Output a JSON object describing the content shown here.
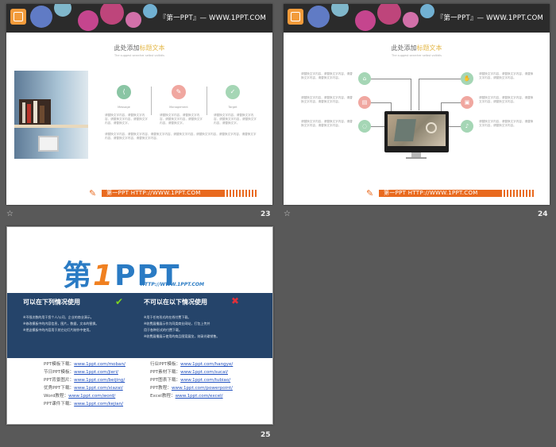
{
  "slides": [
    {
      "number": "23",
      "banner_text": "『第一PPT』— WWW.1PPT.COM",
      "footer_text": "第一PPT HTTP://WWW.1PPT.COM",
      "title_prefix": "此处添加",
      "title_highlight": "标题文本",
      "subtitle": "The suggest searcher selbst voltidis",
      "columns": [
        {
          "label": "Message",
          "color": "#8ac5a4",
          "icon": "share-icon"
        },
        {
          "label": "Management",
          "color": "#f0a7a0",
          "icon": "edit-icon"
        },
        {
          "label": "Target",
          "color": "#a5d6b5",
          "icon": "check-icon"
        }
      ],
      "column_text": "请替换文字内容，请替换文字内容，请替换文字内容，请替换文字内容，请替换文字。",
      "body_text": "请替换文字内容，请替换文字内容，请替换文字内容，请替换文字内容，请替换文字内容，请替换文字内容，请替换文字内容，请替换文字内容，请替换文字内容。"
    },
    {
      "number": "24",
      "banner_text": "『第一PPT』— WWW.1PPT.COM",
      "footer_text": "第一PPT HTTP://WWW.1PPT.COM",
      "title_prefix": "此处添加",
      "title_highlight": "标题文本",
      "subtitle": "The suggest searcher selbst voltidis",
      "left_text": "请替换文字内容，请替换文字内容，请替换文字内容，请替换文字内容。",
      "right_text": "请替换文字内容，请替换文字内容，请替换文字内容，请替换文字内容。",
      "left_icons": [
        {
          "icon": "home-icon",
          "color": "#a5d6b5"
        },
        {
          "icon": "document-icon",
          "color": "#f0a7a0"
        },
        {
          "icon": "bulb-icon",
          "color": "#a5d6b5"
        }
      ],
      "right_icons": [
        {
          "icon": "hand-icon",
          "color": "#a5d6b5"
        },
        {
          "icon": "lock-icon",
          "color": "#f0a7a0"
        },
        {
          "icon": "mic-icon",
          "color": "#a5d6b5"
        }
      ]
    },
    {
      "number": "25",
      "logo_text_a": "第",
      "logo_text_one": "1",
      "logo_text_b": "PPT",
      "logo_url": "HTTP://WWW.1PPT.COM",
      "can_use_title": "可以在下列情况使用",
      "cannot_use_title": "不可以在以下情况使用",
      "can_use_items": [
        "※不限次数的用于您个人/公司、企业的商业演示。",
        "※修改模板中的内容信息，图片，数据，文本的替换。",
        "※把这模板中的内容用于其它幻灯片制作中使用。"
      ],
      "cannot_use_items": [
        "※用于任何形式的在线付费下载。",
        "※收费展播展示作为同类商业网站，打包上传并",
        "  用于各种形式的付费下载。",
        "※收费展播展示使用的商品图案展览，刻录光碟销售。"
      ],
      "links_left": [
        {
          "label": "PPT模板下载：",
          "url": "www.1ppt.com/moban/"
        },
        {
          "label": "节日PPT模板：",
          "url": "www.1ppt.com/jieri/"
        },
        {
          "label": "PPT背景图片：",
          "url": "www.1ppt.com/beijing/"
        },
        {
          "label": "优秀PPT下载：",
          "url": "www.1ppt.com/xiazai/"
        },
        {
          "label": "Word教程：",
          "url": "www.1ppt.com/word/"
        },
        {
          "label": "PPT课件下载：",
          "url": "www.1ppt.com/kejian/"
        }
      ],
      "links_right": [
        {
          "label": "行业PPT模板：",
          "url": "www.1ppt.com/hangye/"
        },
        {
          "label": "PPT素材下载：",
          "url": "www.1ppt.com/sucai/"
        },
        {
          "label": "PPT图表下载：",
          "url": "www.1ppt.com/tubiao/"
        },
        {
          "label": "PPT教程：",
          "url": "www.1ppt.com/powerpoint/"
        },
        {
          "label": "Excel教程：",
          "url": "www.1ppt.com/excel/"
        }
      ]
    }
  ],
  "colors": {
    "background": "#595959",
    "accent_orange": "#e96a1f",
    "panel_blue": "#25446a",
    "logo_blue": "#2a7bc4"
  }
}
